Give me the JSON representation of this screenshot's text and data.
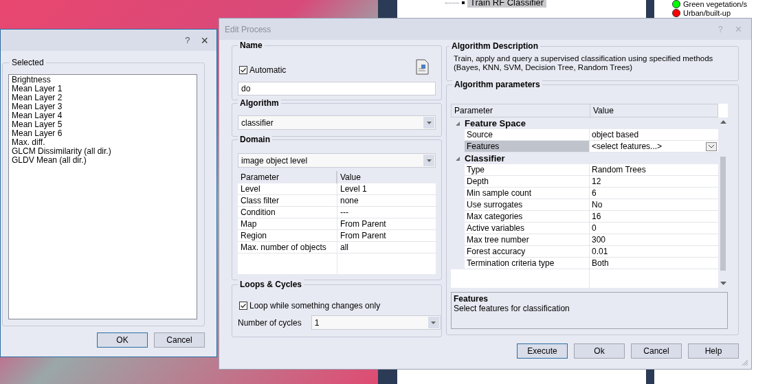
{
  "background": {
    "tree_item": {
      "label": "Train RF Classifier",
      "selected": true
    },
    "legend": [
      {
        "label": "Green vegetation/s",
        "color": "#00ff00"
      },
      {
        "label": "Urban/built-up",
        "color": "#ff0000"
      }
    ]
  },
  "feature_dialog": {
    "help": "?",
    "close": "×",
    "group_label": "Selected",
    "items": [
      "Brightness",
      "Mean Layer 1",
      "Mean Layer 2",
      "Mean Layer 3",
      "Mean Layer 4",
      "Mean Layer 5",
      "Mean Layer 6",
      "Max. diff.",
      "GLCM Dissimilarity (all dir.)",
      "GLDV Mean (all dir.)"
    ],
    "buttons": [
      {
        "label": "OK",
        "default": true
      },
      {
        "label": "Cancel",
        "default": false
      }
    ]
  },
  "edit_process": {
    "title": "Edit Process",
    "help": "?",
    "close": "×",
    "name": {
      "label": "Name",
      "automatic": {
        "label": "Automatic",
        "checked": true
      },
      "value": "do"
    },
    "algorithm": {
      "label": "Algorithm",
      "value": "classifier"
    },
    "domain": {
      "label": "Domain",
      "value": "image object level",
      "columns": [
        "Parameter",
        "Value"
      ],
      "rows": [
        [
          "Level",
          "Level 1"
        ],
        [
          "Class filter",
          "none"
        ],
        [
          "Condition",
          "---"
        ],
        [
          "Map",
          "From Parent"
        ],
        [
          "Region",
          "From Parent"
        ],
        [
          "Max. number of objects",
          "all"
        ]
      ]
    },
    "loops": {
      "label": "Loops & Cycles",
      "loop_only": {
        "label": "Loop while something changes only",
        "checked": true
      },
      "cycles_label": "Number of cycles",
      "cycles_value": "1"
    },
    "description": {
      "label": "Algorithm Description",
      "text": "Train, apply and query a supervised classification using specified methods (Bayes, KNN, SVM, Decision Tree, Random Trees)"
    },
    "parameters": {
      "label": "Algorithm parameters",
      "columns": [
        "Parameter",
        "Value"
      ],
      "groups": [
        {
          "title": "Feature Space",
          "expanded": true,
          "rows": [
            {
              "name": "Source",
              "value": "object based",
              "kind": "text",
              "selected": false
            },
            {
              "name": "Features",
              "value": "<select features...>",
              "kind": "dropdown",
              "selected": true
            }
          ]
        },
        {
          "title": "Classifier",
          "expanded": true,
          "rows": [
            {
              "name": "Type",
              "value": "Random Trees",
              "kind": "text",
              "selected": false
            },
            {
              "name": "Depth",
              "value": "12",
              "kind": "text",
              "selected": false
            },
            {
              "name": "Min sample count",
              "value": "6",
              "kind": "text",
              "selected": false
            },
            {
              "name": "Use surrogates",
              "value": "No",
              "kind": "text",
              "selected": false
            },
            {
              "name": "Max categories",
              "value": "16",
              "kind": "text",
              "selected": false
            },
            {
              "name": "Active variables",
              "value": "0",
              "kind": "text",
              "selected": false
            },
            {
              "name": "Max tree number",
              "value": "300",
              "kind": "text",
              "selected": false
            },
            {
              "name": "Forest accuracy",
              "value": "0.01",
              "kind": "text",
              "selected": false
            },
            {
              "name": "Termination criteria type",
              "value": "Both",
              "kind": "text",
              "selected": false
            }
          ]
        }
      ],
      "help_title": "Features",
      "help_text": "Select features for classification"
    },
    "buttons": [
      {
        "label": "Execute",
        "default": true
      },
      {
        "label": "Ok",
        "default": false
      },
      {
        "label": "Cancel",
        "default": false
      },
      {
        "label": "Help",
        "default": false
      }
    ]
  }
}
